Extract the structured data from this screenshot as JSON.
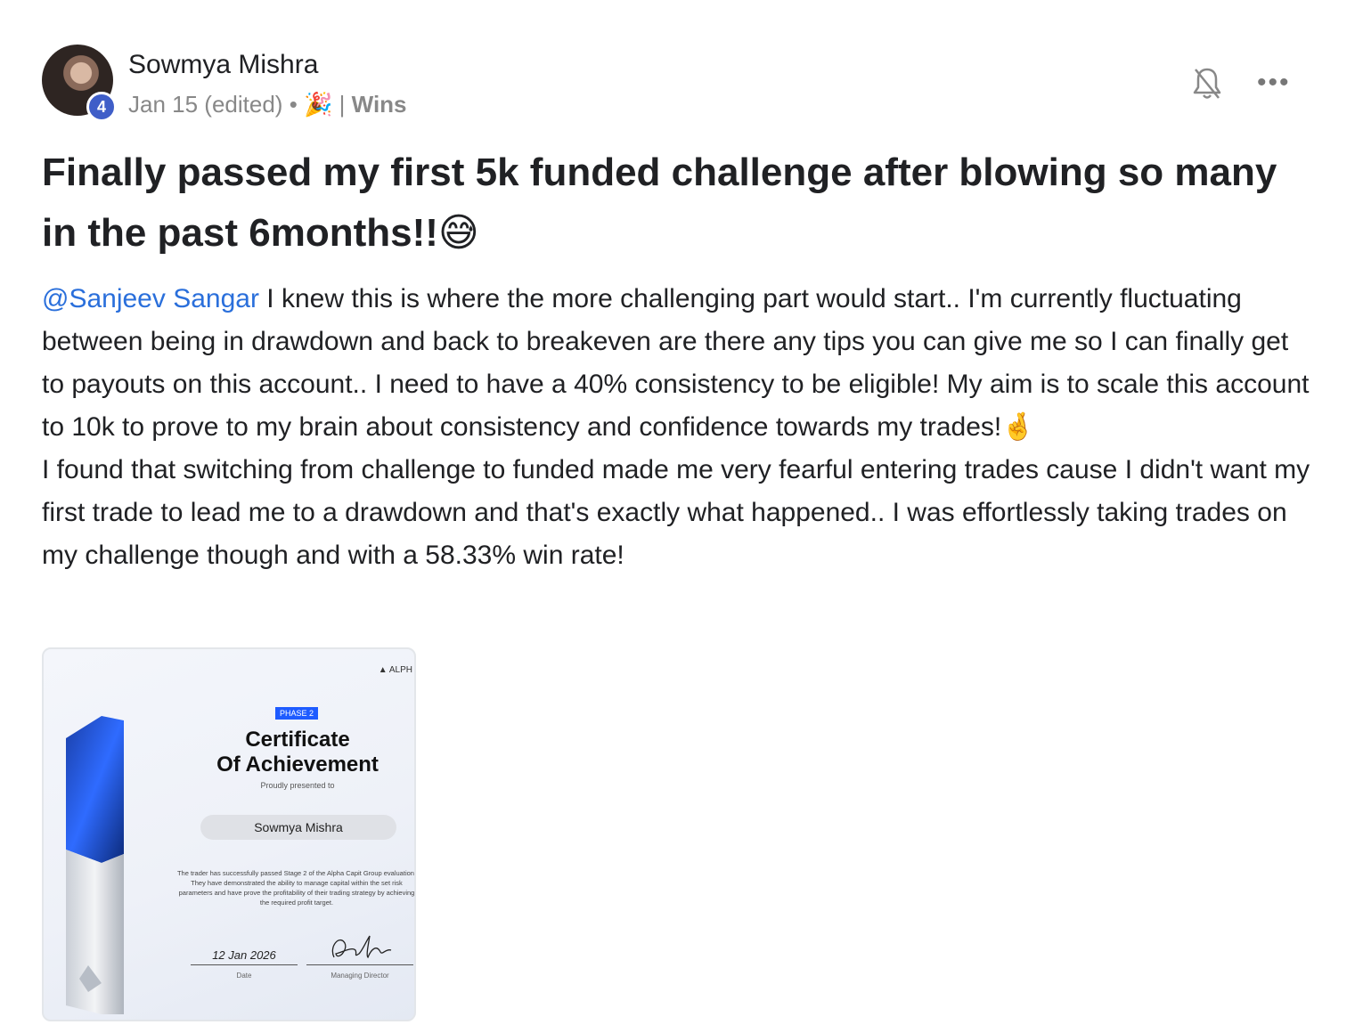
{
  "post": {
    "author": "Sowmya Mishra",
    "level": "4",
    "date": "Jan 15 (edited)",
    "separator": "•",
    "category_emoji": "🎉",
    "category_divider": "|",
    "category": "Wins",
    "title": "Finally passed my first 5k funded challenge after blowing so many in the past 6months!!😅",
    "mention": "@Sanjeev Sangar",
    "paragraph1": " I knew this is where the more challenging part would start.. I'm currently fluctuating between being in drawdown and back to breakeven are there any tips you can give me so I can finally get to payouts on this account.. I need to have a 40% consistency to be eligible! My aim is to scale this account to 10k to prove to my brain about consistency and confidence towards my trades!🤞",
    "paragraph2": "I found that switching from challenge to funded made me very fearful entering trades cause I didn't want my first trade to lead me to a drawdown and that's exactly what happened.. I was effortlessly taking trades on my challenge though and with a 58.33% win rate!"
  },
  "actions": {
    "notifications_icon": "bell-off-icon",
    "more_icon": "more-horizontal-icon",
    "more_label": "•••"
  },
  "certificate": {
    "brand": "ALPH",
    "phase": "PHASE 2",
    "title_line1": "Certificate",
    "title_line2": "Of Achievement",
    "presented": "Proudly presented to",
    "name": "Sowmya Mishra",
    "description": "The trader has successfully passed Stage 2 of the Alpha Capit Group evaluation. They have demonstrated the ability to manage capital within the set risk parameters and have prove the profitability of their trading strategy by achieving the required profit target.",
    "date": "12 Jan 2026",
    "date_label": "Date",
    "director_label": "Managing Director"
  }
}
